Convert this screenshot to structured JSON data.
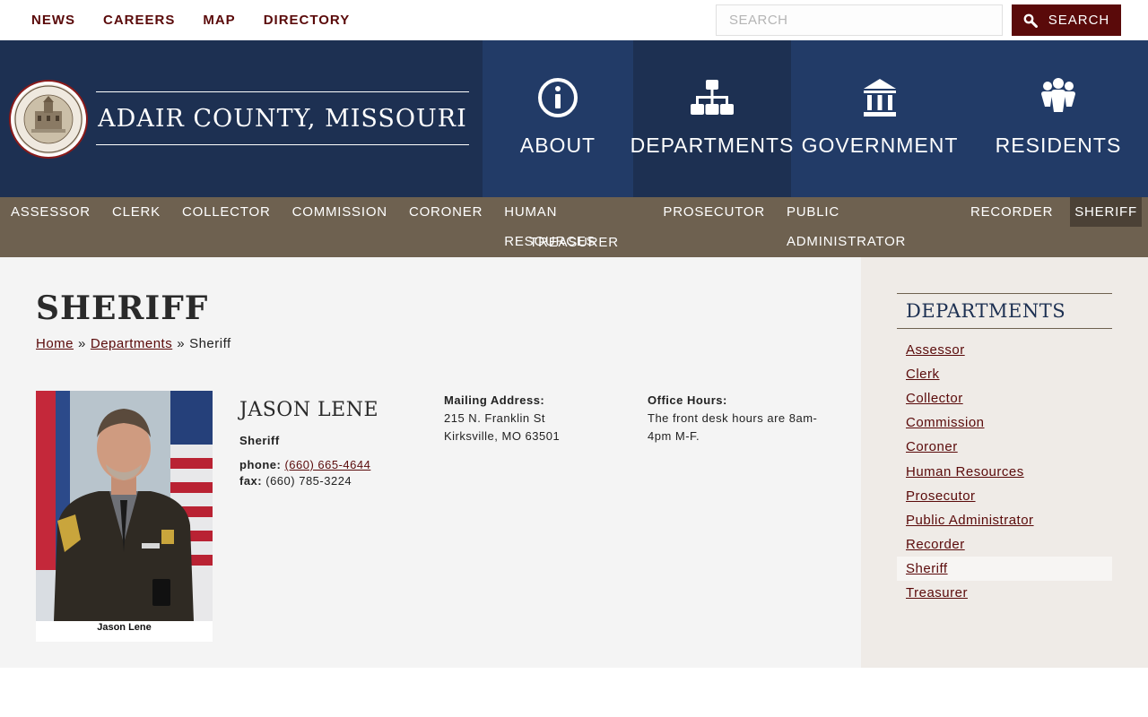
{
  "utility_nav": [
    "NEWS",
    "CAREERS",
    "MAP",
    "DIRECTORY"
  ],
  "search": {
    "placeholder": "SEARCH",
    "button_label": "SEARCH"
  },
  "site": {
    "title": "ADAIR COUNTY, MISSOURI"
  },
  "main_nav": [
    {
      "label": "ABOUT",
      "icon": "info-icon",
      "active": false
    },
    {
      "label": "DEPARTMENTS",
      "icon": "org-chart-icon",
      "active": true
    },
    {
      "label": "GOVERNMENT",
      "icon": "government-building-icon",
      "active": false
    },
    {
      "label": "RESIDENTS",
      "icon": "people-icon",
      "active": false
    }
  ],
  "sub_nav": {
    "row1": [
      "ASSESSOR",
      "CLERK",
      "COLLECTOR",
      "COMMISSION",
      "CORONER",
      "HUMAN RESOURCES",
      "PROSECUTOR",
      "PUBLIC ADMINISTRATOR",
      "RECORDER",
      "SHERIFF"
    ],
    "row2": [
      "TREASURER"
    ],
    "active": "SHERIFF"
  },
  "page": {
    "title": "SHERIFF",
    "breadcrumb": [
      {
        "label": "Home",
        "link": true
      },
      {
        "label": "Departments",
        "link": true
      },
      {
        "label": "Sheriff",
        "link": false
      }
    ],
    "breadcrumb_sep": "»"
  },
  "person": {
    "photo_caption": "Jason Lene",
    "name": "JASON LENE",
    "role": "Sheriff",
    "phone_label": "phone:",
    "phone": "(660) 665-4644",
    "fax_label": "fax:",
    "fax": "(660) 785-3224"
  },
  "mailing": {
    "label": "Mailing Address:",
    "line1": "215 N. Franklin St",
    "line2": "Kirksville, MO 63501"
  },
  "hours": {
    "label": "Office Hours:",
    "text": "The front desk hours are 8am-4pm M-F."
  },
  "sidebar": {
    "title": "DEPARTMENTS",
    "items": [
      "Assessor",
      "Clerk",
      "Collector",
      "Commission",
      "Coroner",
      "Human Resources",
      "Prosecutor",
      "Public Administrator",
      "Recorder",
      "Sheriff",
      "Treasurer"
    ],
    "active": "Sheriff"
  },
  "colors": {
    "navy": "#1d3052",
    "nav_blue": "#223b67",
    "maroon": "#5a0a0a",
    "taupe": "#6e6150",
    "content_bg": "#f4f4f4",
    "sidebar_bg": "#efebe7"
  }
}
